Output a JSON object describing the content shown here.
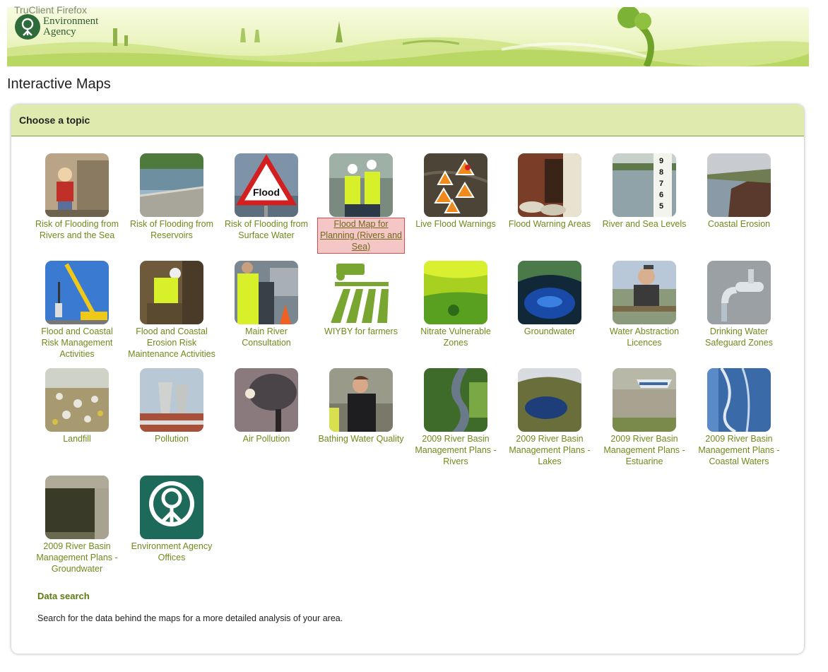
{
  "window": {
    "app_label": "TruClient Firefox"
  },
  "brand": {
    "line1": "Environment",
    "line2": "Agency"
  },
  "page": {
    "title": "Interactive Maps"
  },
  "panel": {
    "heading": "Choose a topic"
  },
  "topics": [
    {
      "label": "Risk of Flooding from Rivers and the Sea",
      "icon": "woman-flood-photo",
      "selected": false
    },
    {
      "label": "Risk of Flooding from Reservoirs",
      "icon": "reservoir-dam-photo",
      "selected": false
    },
    {
      "label": "Risk of Flooding from Surface Water",
      "icon": "flood-sign-photo",
      "selected": false
    },
    {
      "label": "Flood Map for Planning (Rivers and Sea)",
      "icon": "engineers-photo",
      "selected": true
    },
    {
      "label": "Live Flood Warnings",
      "icon": "warning-map-photo",
      "selected": false
    },
    {
      "label": "Flood Warning Areas",
      "icon": "sandbags-photo",
      "selected": false
    },
    {
      "label": "River and Sea Levels",
      "icon": "gauge-board-photo",
      "selected": false
    },
    {
      "label": "Coastal Erosion",
      "icon": "cliff-photo",
      "selected": false
    },
    {
      "label": "Flood and Coastal Risk Management Activities",
      "icon": "crane-photo",
      "selected": false
    },
    {
      "label": "Flood and Coastal Erosion Risk Maintenance Activities",
      "icon": "worker-bank-photo",
      "selected": false
    },
    {
      "label": "Main River Consultation",
      "icon": "inspectors-photo",
      "selected": false
    },
    {
      "label": "WIYBY for farmers",
      "icon": "tractor-field-icon",
      "selected": false
    },
    {
      "label": "Nitrate Vulnerable Zones",
      "icon": "fields-photo",
      "selected": false
    },
    {
      "label": "Groundwater",
      "icon": "cave-water-photo",
      "selected": false
    },
    {
      "label": "Water Abstraction Licences",
      "icon": "man-drinking-photo",
      "selected": false
    },
    {
      "label": "Drinking Water Safeguard Zones",
      "icon": "tap-photo",
      "selected": false
    },
    {
      "label": "Landfill",
      "icon": "landfill-photo",
      "selected": false
    },
    {
      "label": "Pollution",
      "icon": "power-station-photo",
      "selected": false
    },
    {
      "label": "Air Pollution",
      "icon": "chimney-smoke-photo",
      "selected": false
    },
    {
      "label": "Bathing Water Quality",
      "icon": "surfer-photo",
      "selected": false
    },
    {
      "label": "2009 River Basin Management Plans - Rivers",
      "icon": "river-valley-photo",
      "selected": false
    },
    {
      "label": "2009 River Basin Management Plans - Lakes",
      "icon": "lake-photo",
      "selected": false
    },
    {
      "label": "2009 River Basin Management Plans - Estuarine",
      "icon": "estuary-boat-photo",
      "selected": false
    },
    {
      "label": "2009 River Basin Management Plans - Coastal Waters",
      "icon": "coast-aerial-photo",
      "selected": false
    },
    {
      "label": "2009 River Basin Management Plans - Groundwater",
      "icon": "well-water-photo",
      "selected": false
    },
    {
      "label": "Environment Agency Offices",
      "icon": "ea-logo-sign",
      "selected": false
    }
  ],
  "data_search": {
    "title": "Data search",
    "text": "Search for the data behind the maps for a more detailed analysis of your area."
  },
  "colors": {
    "accent_green": "#6f8a1a",
    "panel_header": "#dfeaae",
    "selected_bg": "#f5c6c6"
  }
}
